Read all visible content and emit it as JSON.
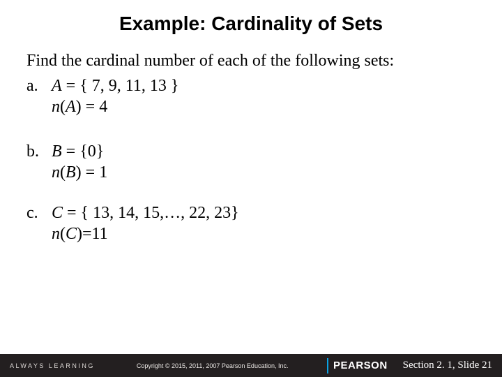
{
  "title": "Example: Cardinality of Sets",
  "intro": "Find the cardinal number of each of the following sets:",
  "items": [
    {
      "marker": "a.",
      "setVar": "A",
      "setDef": " = { 7, 9, 11, 13 }",
      "nVar": "A",
      "nVal": ") = 4"
    },
    {
      "marker": "b.",
      "setVar": "B",
      "setDef": " = {0}",
      "nVar": "B",
      "nVal": ") = 1"
    },
    {
      "marker": "c.",
      "setVar": "C",
      "setDef": " = { 13, 14, 15,…, 22, 23}",
      "nVar": "C",
      "nVal": ")=11"
    }
  ],
  "footer": {
    "always": "ALWAYS LEARNING",
    "copyright": "Copyright © 2015, 2011, 2007 Pearson Education, Inc.",
    "brand": "PEARSON",
    "slide": "Section 2. 1,  Slide 21"
  }
}
